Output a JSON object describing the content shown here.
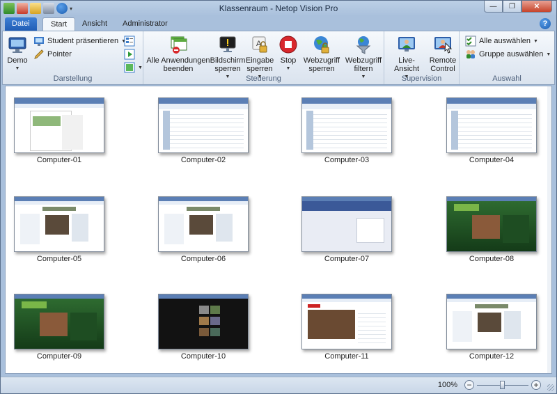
{
  "window": {
    "title": "Klassenraum - Netop Vision Pro"
  },
  "tabs": {
    "file": "Datei",
    "start": "Start",
    "view": "Ansicht",
    "admin": "Administrator"
  },
  "ribbon": {
    "darstellung": {
      "label": "Darstellung",
      "demo": "Demo",
      "student_present": "Student präsentieren",
      "pointer": "Pointer"
    },
    "steuerung": {
      "label": "Steuerung",
      "close_apps_1": "Alle Anwendungen",
      "close_apps_2": "beenden",
      "lock_screen_1": "Bildschirm",
      "lock_screen_2": "sperren",
      "lock_input_1": "Eingabe",
      "lock_input_2": "sperren",
      "stop": "Stop",
      "web_lock_1": "Webzugriff",
      "web_lock_2": "sperren",
      "web_filter_1": "Webzugriff",
      "web_filter_2": "filtern"
    },
    "supervision": {
      "label": "Supervision",
      "live_view": "Live-Ansicht",
      "remote_1": "Remote",
      "remote_2": "Control"
    },
    "auswahl": {
      "label": "Auswahl",
      "select_all": "Alle auswählen",
      "select_group": "Gruppe auswählen"
    }
  },
  "computers": [
    {
      "name": "Computer-01",
      "kind": "doc"
    },
    {
      "name": "Computer-02",
      "kind": "sheet"
    },
    {
      "name": "Computer-03",
      "kind": "sheet"
    },
    {
      "name": "Computer-04",
      "kind": "sheet"
    },
    {
      "name": "Computer-05",
      "kind": "web"
    },
    {
      "name": "Computer-06",
      "kind": "web"
    },
    {
      "name": "Computer-07",
      "kind": "social"
    },
    {
      "name": "Computer-08",
      "kind": "nature"
    },
    {
      "name": "Computer-09",
      "kind": "nature"
    },
    {
      "name": "Computer-10",
      "kind": "dark"
    },
    {
      "name": "Computer-11",
      "kind": "video"
    },
    {
      "name": "Computer-12",
      "kind": "web"
    }
  ],
  "status": {
    "zoom": "100%"
  },
  "colors": {
    "ribbon_blue": "#1f5cb4",
    "accent": "#3d7fd4"
  }
}
